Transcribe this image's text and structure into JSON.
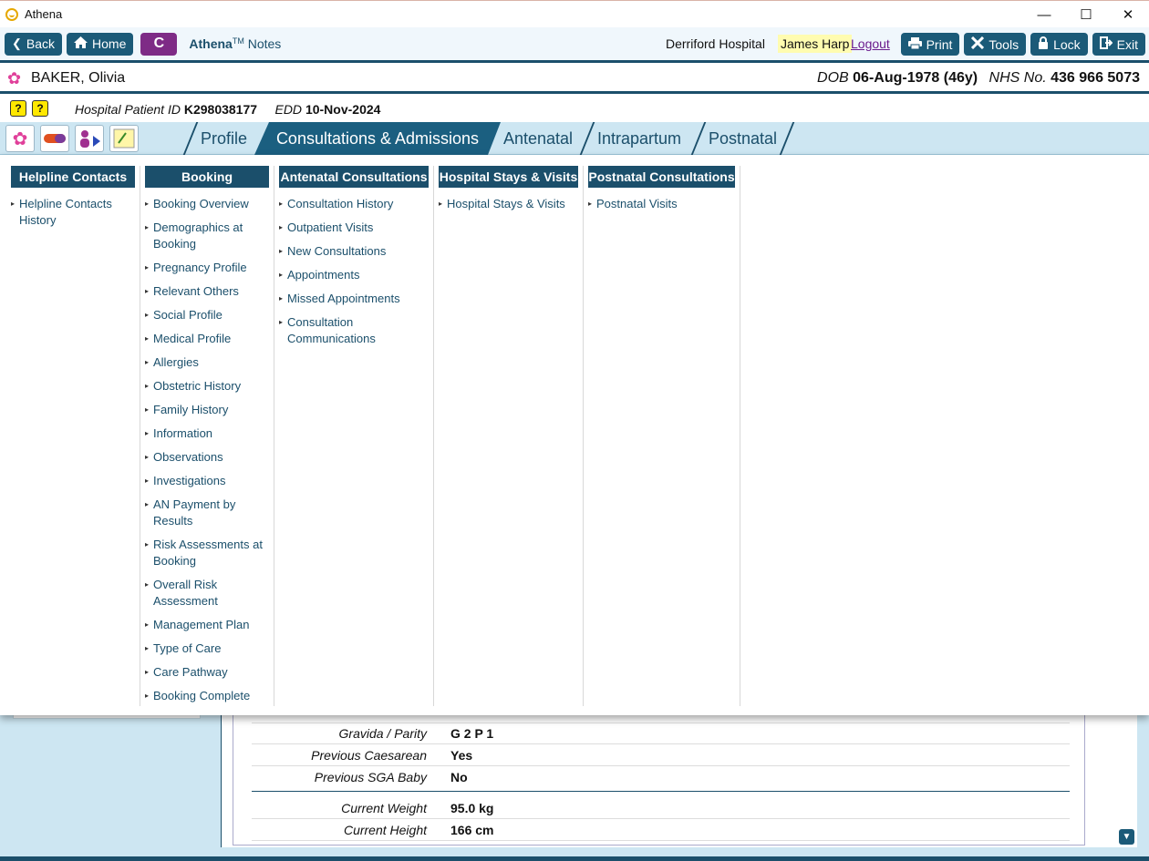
{
  "window": {
    "title": "Athena",
    "minimize": "—",
    "maximize": "☐",
    "close": "✕"
  },
  "toolbar": {
    "back": "Back",
    "home": "Home",
    "c_button": "C",
    "brand_name": "Athena",
    "brand_tm": "TM",
    "brand_suffix": " Notes",
    "hospital": "Derriford Hospital",
    "user": "James Harp",
    "logout": "Logout",
    "print": "Print",
    "tools": "Tools",
    "lock": "Lock",
    "exit": "Exit"
  },
  "patient": {
    "name": "BAKER, Olivia",
    "dob_label": "DOB",
    "dob": "06-Aug-1978 (46y)",
    "nhs_label": "NHS No.",
    "nhs": "436 966 5073"
  },
  "subinfo": {
    "hpid_label": "Hospital Patient ID",
    "hpid": "K298038177",
    "edd_label": "EDD",
    "edd": "10-Nov-2024"
  },
  "tabs": [
    {
      "label": "Profile",
      "active": false
    },
    {
      "label": "Consultations & Admissions",
      "active": true
    },
    {
      "label": "Antenatal",
      "active": false
    },
    {
      "label": "Intrapartum",
      "active": false
    },
    {
      "label": "Postnatal",
      "active": false
    }
  ],
  "menu": {
    "columns": [
      {
        "heading": "Helpline Contacts",
        "items": [
          "Helpline Contacts History"
        ]
      },
      {
        "heading": "Booking",
        "items": [
          "Booking Overview",
          "Demographics at Booking",
          "Pregnancy Profile",
          "Relevant Others",
          "Social Profile",
          "Medical Profile",
          "Allergies",
          "Obstetric History",
          "Family History",
          "Information",
          "Observations",
          "Investigations",
          "AN Payment by Results",
          "Risk Assessments at Booking",
          "Overall Risk Assessment",
          "Management Plan",
          "Type of Care",
          "Care Pathway",
          "Booking Complete"
        ]
      },
      {
        "heading": "Antenatal Consultations",
        "items": [
          "Consultation History",
          "Outpatient Visits",
          "New Consultations",
          "Appointments",
          "Missed Appointments",
          "Consultation Communications"
        ]
      },
      {
        "heading": "Hospital Stays & Visits",
        "items": [
          "Hospital Stays & Visits"
        ]
      },
      {
        "heading": "Postnatal Consultations",
        "items": [
          "Postnatal Visits"
        ]
      }
    ]
  },
  "background": {
    "rows": [
      {
        "label": "Gravida / Parity",
        "value": "G 2 P 1"
      },
      {
        "label": "Previous Caesarean",
        "value": "Yes"
      },
      {
        "label": "Previous SGA Baby",
        "value": "No"
      },
      {
        "label": "Current Weight",
        "value": "95.0 kg"
      },
      {
        "label": "Current Height",
        "value": "166 cm"
      }
    ]
  },
  "colors": {
    "primary": "#1b4f6b",
    "accent": "#7e2b86",
    "tabbar": "#cde6f2"
  }
}
